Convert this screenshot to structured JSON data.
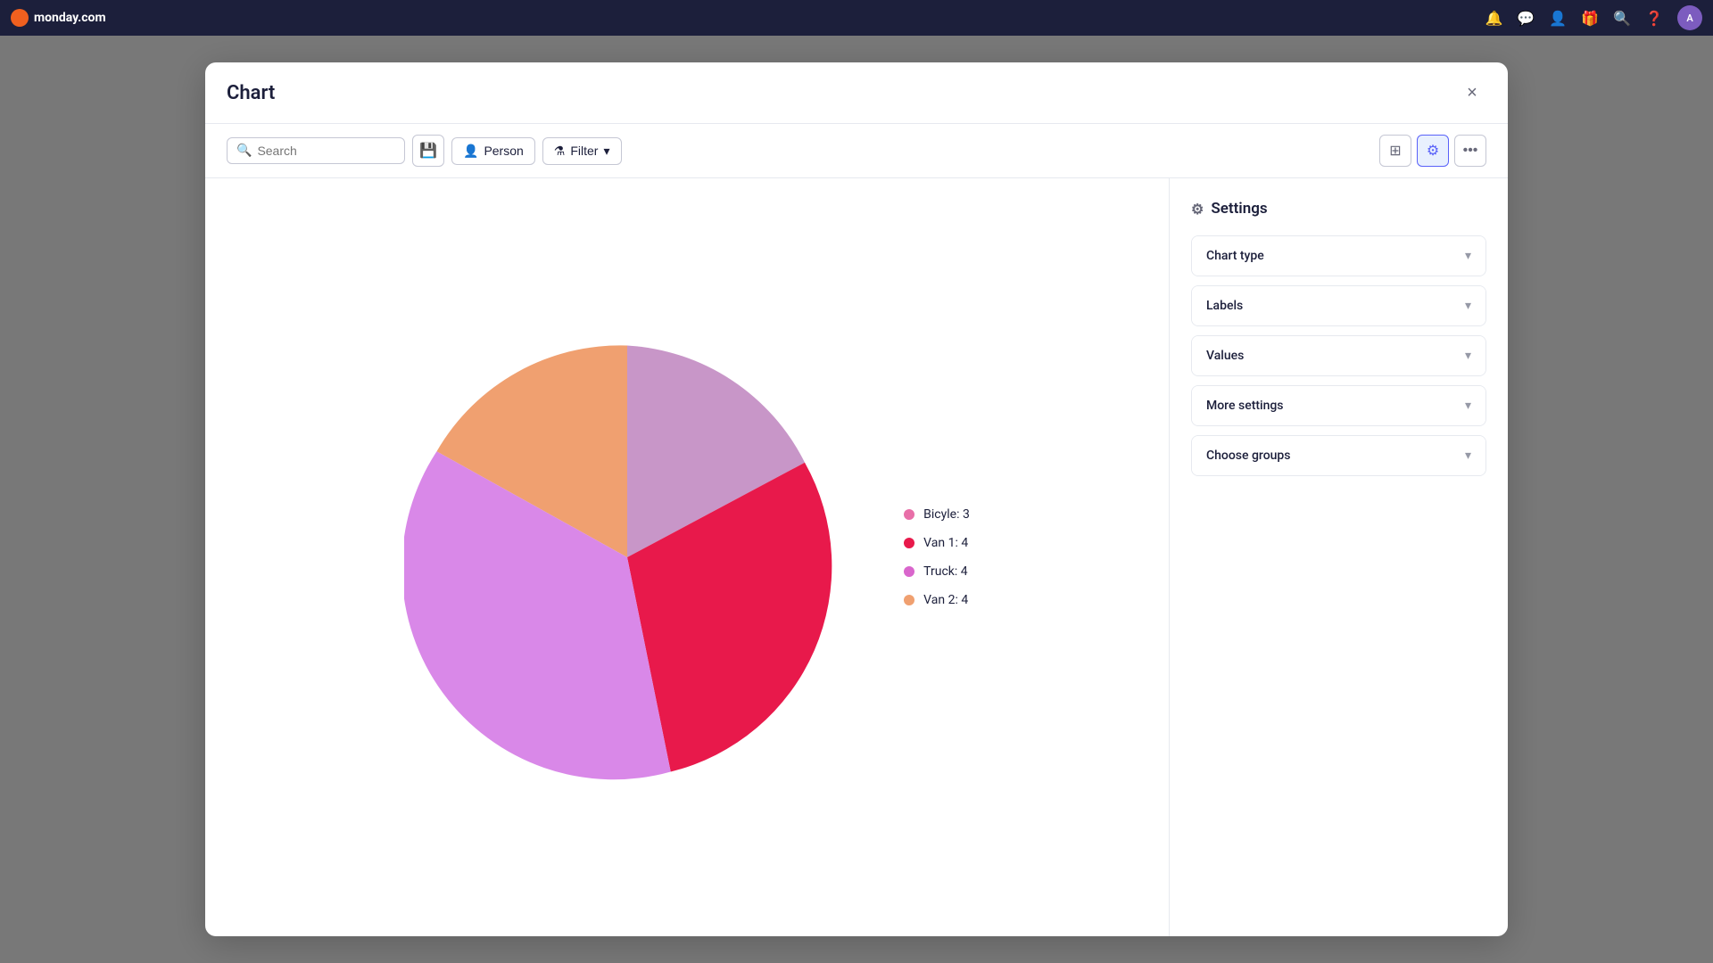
{
  "topbar": {
    "app_name": "monday.com",
    "icons": [
      "bell",
      "chat",
      "person",
      "gift",
      "search",
      "help"
    ]
  },
  "modal": {
    "title": "Chart",
    "close_label": "×",
    "toolbar": {
      "search_placeholder": "Search",
      "search_label": "Search",
      "person_label": "Person",
      "filter_label": "Filter",
      "save_icon": "💾",
      "layout_icon": "⊞",
      "settings_icon": "⚙",
      "more_icon": "…"
    },
    "settings": {
      "title": "Settings",
      "sections": [
        {
          "id": "chart-type",
          "label": "Chart type"
        },
        {
          "id": "labels",
          "label": "Labels"
        },
        {
          "id": "values",
          "label": "Values"
        },
        {
          "id": "more-settings",
          "label": "More settings"
        },
        {
          "id": "choose-groups",
          "label": "Choose groups"
        }
      ]
    },
    "chart": {
      "legend": [
        {
          "id": "bicycle",
          "label": "Bicyle: 3",
          "color": "#e86fa8",
          "value": 3
        },
        {
          "id": "van1",
          "label": "Van 1: 4",
          "color": "#e8194b",
          "value": 4
        },
        {
          "id": "truck",
          "label": "Truck: 4",
          "color": "#d966cc",
          "value": 4
        },
        {
          "id": "van2",
          "label": "Van 2: 4",
          "color": "#f0a070",
          "value": 4
        }
      ]
    }
  }
}
